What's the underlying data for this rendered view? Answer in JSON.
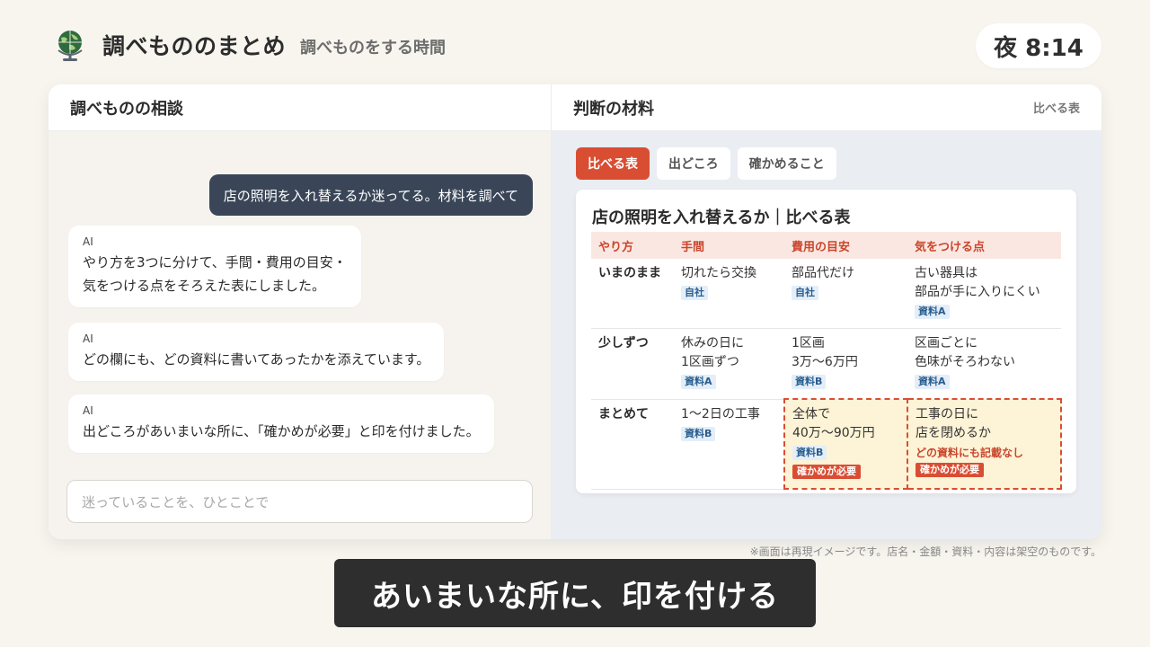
{
  "header": {
    "icon": "globe-icon",
    "title": "調べもののまとめ",
    "subtitle": "調べものをする時間",
    "clock": "夜 8:14"
  },
  "chat": {
    "panel_title": "調べものの相談",
    "user_message": "店の照明を入れ替えるか迷ってる。材料を調べて",
    "ai_messages": [
      {
        "sender": "AI",
        "lines": [
          "やり方を3つに分けて、手間・費用の目安・",
          "気をつける点をそろえた表にしました。"
        ]
      },
      {
        "sender": "AI",
        "lines": [
          "どの欄にも、どの資料に書いてあったかを添えています。"
        ]
      },
      {
        "sender": "AI",
        "lines": [
          "出どころがあいまいな所に、「確かめが必要」と印を付けました。"
        ]
      }
    ],
    "input_placeholder": "迷っていることを、ひとことで"
  },
  "materials": {
    "panel_title": "判断の材料",
    "head_link": "比べる表",
    "tabs": [
      {
        "label": "比べる表",
        "active": true
      },
      {
        "label": "出どころ",
        "active": false
      },
      {
        "label": "確かめること",
        "active": false
      }
    ],
    "table_title": "店の照明を入れ替えるか｜比べる表",
    "columns": [
      "やり方",
      "手間",
      "費用の目安",
      "気をつける点"
    ],
    "rows": [
      {
        "name": "いまのまま",
        "effort": {
          "lines": [
            "切れたら交換"
          ],
          "source": "自社"
        },
        "cost": {
          "lines": [
            "部品代だけ"
          ],
          "source": "自社"
        },
        "caution": {
          "lines": [
            "古い器具は",
            "部品が手に入りにくい"
          ],
          "source": "資料A"
        }
      },
      {
        "name": "少しずつ",
        "effort": {
          "lines": [
            "休みの日に",
            "1区画ずつ"
          ],
          "source": "資料A"
        },
        "cost": {
          "lines": [
            "1区画",
            "3万〜6万円"
          ],
          "source": "資料B"
        },
        "caution": {
          "lines": [
            "区画ごとに",
            "色味がそろわない"
          ],
          "source": "資料A"
        }
      },
      {
        "name": "まとめて",
        "effort": {
          "lines": [
            "1〜2日の工事"
          ],
          "source": "資料B"
        },
        "cost": {
          "lines": [
            "全体で",
            "40万〜90万円"
          ],
          "source": "資料B",
          "warning": "確かめが必要"
        },
        "caution": {
          "lines": [
            "工事の日に",
            "店を閉めるか"
          ],
          "note": "どの資料にも記載なし",
          "warning": "確かめが必要"
        }
      }
    ]
  },
  "footer": {
    "disclaimer": "※画面は再現イメージです。店名・金額・資料・内容は架空のものです。",
    "caption": "あいまいな所に、印を付ける"
  },
  "colors": {
    "accent": "#d94e33",
    "user_bubble": "#3a4658",
    "flag_fill": "#fdf3d6"
  }
}
